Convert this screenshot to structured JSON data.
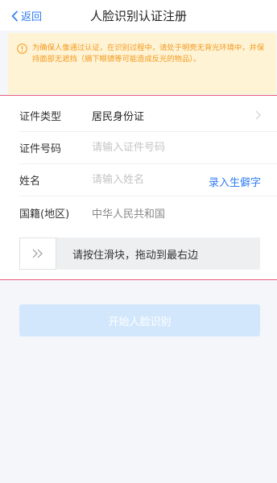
{
  "nav": {
    "back_label": "返回",
    "title": "人脸识别认证注册"
  },
  "notice": {
    "text": "为确保人像通过认证，在识别过程中，请处于明亮无背光环境中，并保持面部无遮挡（摘下眼镜等可能造成反光的物品）。"
  },
  "form": {
    "id_type": {
      "label": "证件类型",
      "value": "居民身份证"
    },
    "id_number": {
      "label": "证件号码",
      "placeholder": "请输入证件号码"
    },
    "name": {
      "label": "姓名",
      "placeholder": "请输入姓名",
      "link": "录入生僻字"
    },
    "nationality": {
      "label": "国籍(地区)",
      "value": "中华人民共和国"
    }
  },
  "slider": {
    "text": "请按住滑块，拖动到最右边"
  },
  "start_button": {
    "label": "开始人脸识别"
  },
  "colors": {
    "accent": "#2f7cf6",
    "notice_text": "#f29a1b",
    "notice_bg": "#fff3d6",
    "button_disabled": "#d3e7fc"
  }
}
